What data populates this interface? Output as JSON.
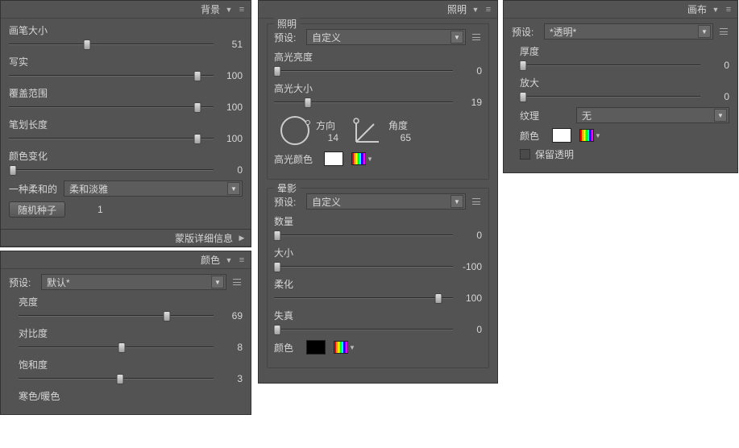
{
  "panels": {
    "background": {
      "title": "背景",
      "brushSize": {
        "label": "画笔大小",
        "value": 51,
        "pos": 38
      },
      "realism": {
        "label": "写实",
        "value": 100,
        "pos": 92
      },
      "coverage": {
        "label": "覆盖范围",
        "value": 100,
        "pos": 92
      },
      "strokeLength": {
        "label": "笔划长度",
        "value": 100,
        "pos": 92
      },
      "colorVariation": {
        "label": "颜色变化",
        "value": 0,
        "pos": 2
      },
      "styleLabel": "一种柔和的",
      "styleValue": "柔和淡雅",
      "randomSeedBtn": "随机种子",
      "randomSeedVal": "1"
    },
    "maskDetail": {
      "title": "蒙版详细信息"
    },
    "color": {
      "title": "颜色",
      "presetLabel": "预设:",
      "presetValue": "默认*",
      "brightness": {
        "label": "亮度",
        "value": 69,
        "pos": 76
      },
      "contrast": {
        "label": "对比度",
        "value": 8,
        "pos": 53
      },
      "saturation": {
        "label": "饱和度",
        "value": 3,
        "pos": 52
      },
      "warmCool": {
        "label": "寒色/暖色"
      }
    },
    "lighting": {
      "title": "照明",
      "group1": {
        "title": "照明",
        "presetLabel": "预设:",
        "presetValue": "自定义",
        "highlightBrightness": {
          "label": "高光亮度",
          "value": 0,
          "pos": 2
        },
        "highlightSize": {
          "label": "高光大小",
          "value": 19,
          "pos": 19
        },
        "directionLabel": "方向",
        "directionValue": "14",
        "angleLabel": "角度",
        "angleValue": "65",
        "highlightColorLabel": "高光颜色"
      },
      "group2": {
        "title": "晕影",
        "presetLabel": "预设:",
        "presetValue": "自定义",
        "amount": {
          "label": "数量",
          "value": 0,
          "pos": 2
        },
        "size": {
          "label": "大小",
          "value": -100,
          "pos": 2
        },
        "soften": {
          "label": "柔化",
          "value": 100,
          "pos": 92
        },
        "distortion": {
          "label": "失真",
          "value": 0,
          "pos": 2
        },
        "colorLabel": "颜色"
      }
    },
    "canvas": {
      "title": "画布",
      "presetLabel": "预设:",
      "presetValue": "*透明*",
      "thickness": {
        "label": "厚度",
        "value": 0,
        "pos": 2
      },
      "magnify": {
        "label": "放大",
        "value": 0,
        "pos": 2
      },
      "textureLabel": "纹理",
      "textureValue": "无",
      "colorLabel": "颜色",
      "preserveLabel": "保留透明"
    }
  }
}
